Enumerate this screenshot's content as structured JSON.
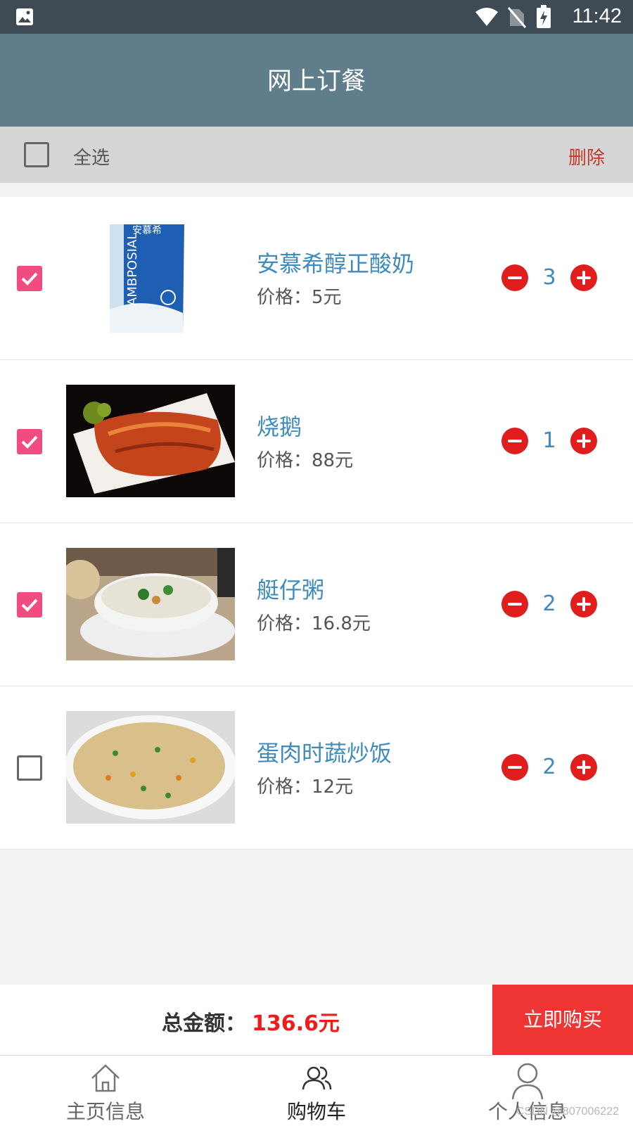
{
  "status_bar": {
    "time": "11:42"
  },
  "toolbar": {
    "title": "网上订餐"
  },
  "select_bar": {
    "select_all_label": "全选",
    "delete_label": "删除"
  },
  "cart": {
    "items": [
      {
        "name": "安慕希醇正酸奶",
        "price_label": "价格：",
        "price": "5元",
        "quantity": "3",
        "checked": true,
        "image": "yogurt-carton-photo"
      },
      {
        "name": "烧鹅",
        "price_label": "价格：",
        "price": "88元",
        "quantity": "1",
        "checked": true,
        "image": "roast-goose-photo"
      },
      {
        "name": "艇仔粥",
        "price_label": "价格：",
        "price": "16.8元",
        "quantity": "2",
        "checked": true,
        "image": "congee-bowl-photo"
      },
      {
        "name": "蛋肉时蔬炒饭",
        "price_label": "价格：",
        "price": "12元",
        "quantity": "2",
        "checked": false,
        "image": "fried-rice-photo"
      }
    ]
  },
  "total_bar": {
    "total_label": "总金额：",
    "total_amount": "136.6元",
    "buy_label": "立即购买"
  },
  "nav": {
    "items": [
      {
        "label": "主页信息",
        "icon": "home-icon"
      },
      {
        "label": "购物车",
        "icon": "users-icon",
        "active": true
      },
      {
        "label": "个人信息",
        "icon": "person-icon"
      }
    ]
  },
  "watermark": "CSDN @807006222",
  "colors": {
    "accent": "#f04c7f",
    "toolbar": "#607d8b",
    "buy": "#ef3434",
    "link": "#3f8bbd"
  }
}
